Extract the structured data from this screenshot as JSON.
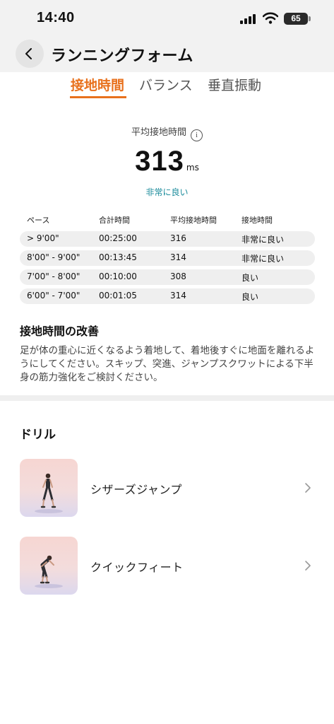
{
  "status_bar": {
    "time": "14:40",
    "battery": "65"
  },
  "header": {
    "title": "ランニングフォーム"
  },
  "tabs": [
    {
      "label": "接地時間",
      "active": true
    },
    {
      "label": "バランス",
      "active": false
    },
    {
      "label": "垂直振動",
      "active": false
    }
  ],
  "summary": {
    "label": "平均接地時間",
    "value": "313",
    "unit": "ms",
    "rating": "非常に良い"
  },
  "table": {
    "headers": [
      "ペース",
      "合計時間",
      "平均接地時間",
      "接地時間"
    ],
    "rows": [
      [
        "> 9'00\"",
        "00:25:00",
        "316",
        "非常に良い"
      ],
      [
        "8'00\" - 9'00\"",
        "00:13:45",
        "314",
        "非常に良い"
      ],
      [
        "7'00\" - 8'00\"",
        "00:10:00",
        "308",
        "良い"
      ],
      [
        "6'00\" - 7'00\"",
        "00:01:05",
        "314",
        "良い"
      ]
    ]
  },
  "improvement": {
    "title": "接地時間の改善",
    "text": "足が体の重心に近くなるよう着地して、着地後すぐに地面を離れるようにしてください。スキップ、突進、ジャンプスクワットによる下半身の筋力強化をご検討ください。"
  },
  "drills": {
    "title": "ドリル",
    "items": [
      {
        "label": "シザーズジャンプ"
      },
      {
        "label": "クイックフィート"
      }
    ]
  },
  "colors": {
    "accent": "#e8711d",
    "rating": "#1a8b9b",
    "background": "#f2f2f2"
  },
  "icons": [
    "signal-icon",
    "wifi-icon",
    "battery-icon",
    "back-arrow-icon",
    "info-icon",
    "chevron-right-icon"
  ]
}
